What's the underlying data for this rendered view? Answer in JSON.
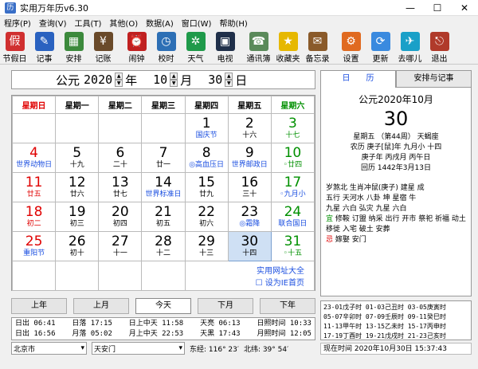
{
  "window": {
    "title": "实用万年历v6.30",
    "min": "—",
    "max": "☐",
    "close": "✕"
  },
  "menu": [
    "程序(P)",
    "查询(V)",
    "工具(T)",
    "其他(O)",
    "数据(A)",
    "窗口(W)",
    "帮助(H)"
  ],
  "toolbar": [
    {
      "label": "节假日",
      "icon": "holiday-icon",
      "color": "#d03030",
      "glyph": "假"
    },
    {
      "label": "记事",
      "icon": "notebook-icon",
      "color": "#2a62c0",
      "glyph": "✎"
    },
    {
      "label": "安排",
      "icon": "schedule-icon",
      "color": "#3c8a3c",
      "glyph": "▦"
    },
    {
      "label": "记账",
      "icon": "ledger-icon",
      "color": "#6a4a2a",
      "glyph": "¥"
    },
    {
      "label": "闹钟",
      "icon": "alarm-clock-icon",
      "color": "#c02020",
      "glyph": "⏰"
    },
    {
      "label": "校时",
      "icon": "time-sync-icon",
      "color": "#2d6fb5",
      "glyph": "◷"
    },
    {
      "label": "天气",
      "icon": "weather-icon",
      "color": "#1f9a4a",
      "glyph": "✲"
    },
    {
      "label": "电视",
      "icon": "tv-icon",
      "color": "#20304a",
      "glyph": "▣"
    },
    {
      "label": "通讯簿",
      "icon": "address-book-icon",
      "color": "#5a8a5a",
      "glyph": "☎"
    },
    {
      "label": "收藏夹",
      "icon": "favorites-icon",
      "color": "#e6b800",
      "glyph": "★"
    },
    {
      "label": "备忘录",
      "icon": "memo-icon",
      "color": "#8a5a2a",
      "glyph": "✉"
    },
    {
      "label": "设置",
      "icon": "settings-icon",
      "color": "#e06a20",
      "glyph": "⚙"
    },
    {
      "label": "更新",
      "icon": "update-icon",
      "color": "#3a8adf",
      "glyph": "⟳"
    },
    {
      "label": "去哪儿",
      "icon": "camel-icon",
      "color": "#1aa0c8",
      "glyph": "✈"
    },
    {
      "label": "退出",
      "icon": "exit-icon",
      "color": "#b03a2a",
      "glyph": "⎋"
    }
  ],
  "datebar": {
    "prefix": "公元",
    "year": "2020",
    "year_unit": "年",
    "month": "10",
    "month_unit": "月",
    "day": "30",
    "day_unit": "日"
  },
  "weekdays": [
    "星期日",
    "星期一",
    "星期二",
    "星期三",
    "星期四",
    "星期五",
    "星期六"
  ],
  "weeks": [
    [
      {
        "n": "",
        "s": ""
      },
      {
        "n": "",
        "s": ""
      },
      {
        "n": "",
        "s": ""
      },
      {
        "n": "",
        "s": ""
      },
      {
        "n": "1",
        "s": "国庆节",
        "nc": "",
        "sc": "blu"
      },
      {
        "n": "2",
        "s": "十六",
        "nc": "",
        "sc": ""
      },
      {
        "n": "3",
        "s": "十七",
        "nc": "grn",
        "sc": "grn"
      }
    ],
    [
      {
        "n": "4",
        "s": "世界动物日",
        "nc": "red",
        "sc": "blu"
      },
      {
        "n": "5",
        "s": "十九",
        "nc": "",
        "sc": ""
      },
      {
        "n": "6",
        "s": "二十",
        "nc": "",
        "sc": ""
      },
      {
        "n": "7",
        "s": "廿一",
        "nc": "",
        "sc": ""
      },
      {
        "n": "8",
        "s": "◎高血压日",
        "nc": "",
        "sc": "blu"
      },
      {
        "n": "9",
        "s": "世界邮政日",
        "nc": "",
        "sc": "blu"
      },
      {
        "n": "10",
        "s": "◦廿四",
        "nc": "grn",
        "sc": "grn"
      }
    ],
    [
      {
        "n": "11",
        "s": "廿五",
        "nc": "red",
        "sc": "red"
      },
      {
        "n": "12",
        "s": "廿六",
        "nc": "",
        "sc": ""
      },
      {
        "n": "13",
        "s": "廿七",
        "nc": "",
        "sc": ""
      },
      {
        "n": "14",
        "s": "世界标准日",
        "nc": "",
        "sc": "blu"
      },
      {
        "n": "15",
        "s": "廿九",
        "nc": "",
        "sc": ""
      },
      {
        "n": "16",
        "s": "三十",
        "nc": "",
        "sc": ""
      },
      {
        "n": "17",
        "s": "◦九月小",
        "nc": "grn",
        "sc": "blu"
      }
    ],
    [
      {
        "n": "18",
        "s": "初二",
        "nc": "red",
        "sc": "red"
      },
      {
        "n": "19",
        "s": "初三",
        "nc": "",
        "sc": ""
      },
      {
        "n": "20",
        "s": "初四",
        "nc": "",
        "sc": ""
      },
      {
        "n": "21",
        "s": "初五",
        "nc": "",
        "sc": ""
      },
      {
        "n": "22",
        "s": "初六",
        "nc": "",
        "sc": ""
      },
      {
        "n": "23",
        "s": "◎霜降",
        "nc": "",
        "sc": "blu"
      },
      {
        "n": "24",
        "s": "联合国日",
        "nc": "grn",
        "sc": "blu"
      }
    ],
    [
      {
        "n": "25",
        "s": "重阳节",
        "nc": "red",
        "sc": "blu"
      },
      {
        "n": "26",
        "s": "初十",
        "nc": "",
        "sc": ""
      },
      {
        "n": "27",
        "s": "十一",
        "nc": "",
        "sc": ""
      },
      {
        "n": "28",
        "s": "十二",
        "nc": "",
        "sc": ""
      },
      {
        "n": "29",
        "s": "十三",
        "nc": "",
        "sc": ""
      },
      {
        "n": "30",
        "s": "十四",
        "nc": "",
        "sc": "",
        "sel": true
      },
      {
        "n": "31",
        "s": "◦十五",
        "nc": "grn",
        "sc": "grn"
      }
    ]
  ],
  "links": {
    "site": "实用网址大全",
    "homepage": "设为IE首页"
  },
  "buttons": [
    "上年",
    "上月",
    "今天",
    "下月",
    "下年"
  ],
  "sun": [
    [
      "日出 06:41",
      "日落 17:15",
      "日上中天 11:58",
      "天亮 06:13",
      "日照时间 10:33"
    ],
    [
      "日出 16:56",
      "月落 05:02",
      "月上中天 22:53",
      "天黑 17:43",
      "月照时间 12:05"
    ]
  ],
  "location": {
    "city": "北京市",
    "district": "天安门",
    "lon": "东经: 116° 23′",
    "lat": "北纬: 39° 54′"
  },
  "tabs": [
    "日　　历",
    "安排与记事"
  ],
  "info": {
    "header": "公元2020年10月",
    "day": "30",
    "line1": "星期五 （第44周） 天蝎座",
    "line2": "农历 庚子[鼠]年 九月小 十四",
    "line3": "庚子年 丙戌月 丙午日",
    "line4": "回历 1442年3月13日",
    "r1": "岁煞北 生肖冲鼠(庚子) 建星 成",
    "r2": "五行 天河水 八卦 坤 星宿 牛",
    "r3": "九星 六白 弘灾 九星 六白",
    "yi_label": "宜",
    "yi": "修鞍 订盟 纳采 出行 开市 祭祀 祈福 动土 移徙 入宅 破土 安葬",
    "ji_label": "忌",
    "ji": "嫁娶 安门"
  },
  "ganzhi": [
    "23-01戊子时 01-03己丑时 03-05庚寅时",
    "05-07辛卯时 07-09壬辰时 09-11癸巳时",
    "11-13甲午时 13-15乙未时 15-17丙申时",
    "17-19丁酉时 19-21戊戌时 21-23己亥时"
  ],
  "now": "现在时间 2020年10月30日 15:37:43"
}
